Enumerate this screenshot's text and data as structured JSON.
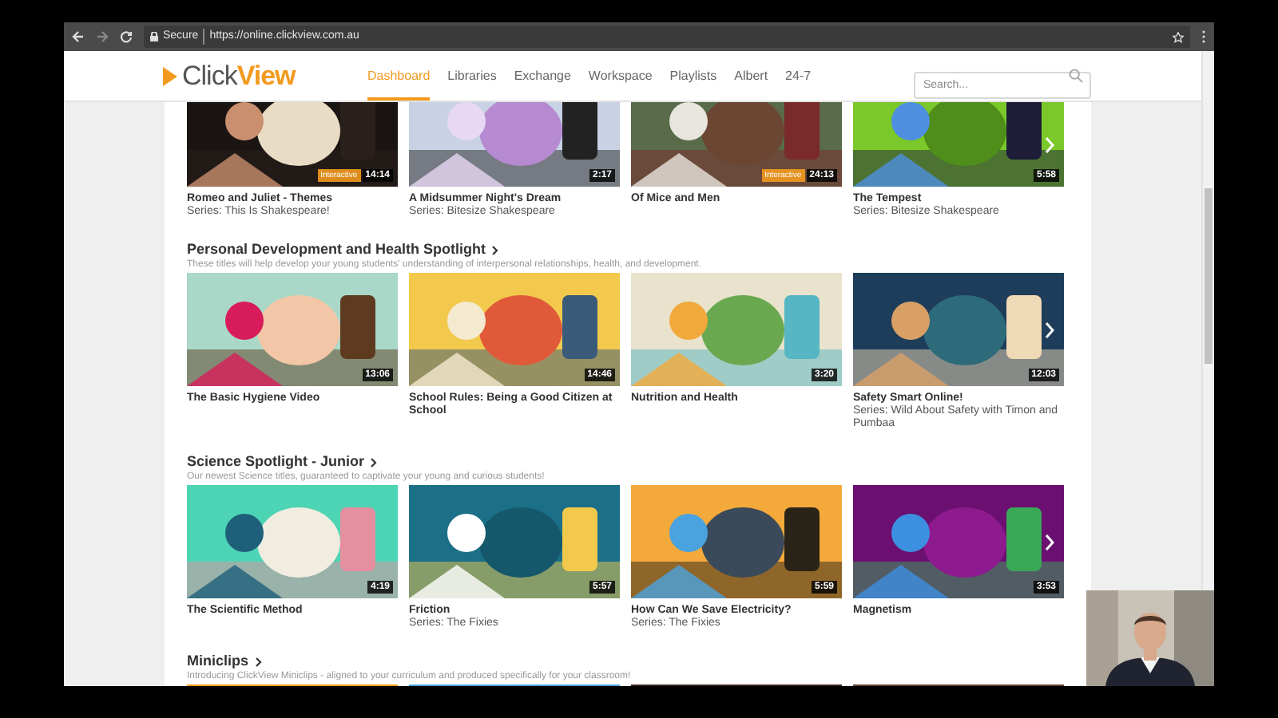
{
  "browser": {
    "secure_label": "Secure",
    "url": "https://online.clickview.com.au"
  },
  "nav": {
    "logo_plain": "Click",
    "logo_bold": "View",
    "items": [
      {
        "label": "Dashboard",
        "selected": true
      },
      {
        "label": "Libraries",
        "selected": false
      },
      {
        "label": "Exchange",
        "selected": false
      },
      {
        "label": "Workspace",
        "selected": false
      },
      {
        "label": "Playlists",
        "selected": false
      },
      {
        "label": "Albert",
        "selected": false
      },
      {
        "label": "24-7",
        "selected": false
      }
    ],
    "search": {
      "placeholder": "Search..."
    }
  },
  "sections": [
    {
      "videos": [
        {
          "title": "Romeo and Juliet - Themes",
          "series": "Series: This Is Shakespeare!",
          "duration": "14:14",
          "badge": "Interactive"
        },
        {
          "title": "A Midsummer Night's Dream",
          "series": "Series: Bitesize Shakespeare",
          "duration": "2:17"
        },
        {
          "title": "Of Mice and Men",
          "duration": "24:13",
          "badge": "Interactive"
        },
        {
          "title": "The Tempest",
          "series": "Series: Bitesize Shakespeare",
          "duration": "5:58"
        }
      ]
    },
    {
      "title": "Personal Development and Health Spotlight",
      "subtitle": "These titles will help develop your young students' understanding of interpersonal relationships, health, and development.",
      "videos": [
        {
          "title": "The Basic Hygiene Video",
          "duration": "13:06"
        },
        {
          "title": "School Rules: Being a Good Citizen at School",
          "duration": "14:46"
        },
        {
          "title": "Nutrition and Health",
          "duration": "3:20"
        },
        {
          "title": "Safety Smart Online!",
          "series": "Series: Wild About Safety with Timon and Pumbaa",
          "duration": "12:03"
        }
      ]
    },
    {
      "title": "Science Spotlight - Junior",
      "subtitle": "Our newest Science titles, guaranteed to captivate your young and curious students!",
      "videos": [
        {
          "title": "The Scientific Method",
          "duration": "4:19"
        },
        {
          "title": "Friction",
          "series": "Series: The Fixies",
          "duration": "5:57"
        },
        {
          "title": "How Can We Save Electricity?",
          "series": "Series: The Fixies",
          "duration": "5:59"
        },
        {
          "title": "Magnetism",
          "duration": "3:53"
        }
      ]
    },
    {
      "title": "Miniclips",
      "subtitle": "Introducing ClickView Miniclips - aligned to your curriculum and produced specifically for your classroom!"
    }
  ]
}
